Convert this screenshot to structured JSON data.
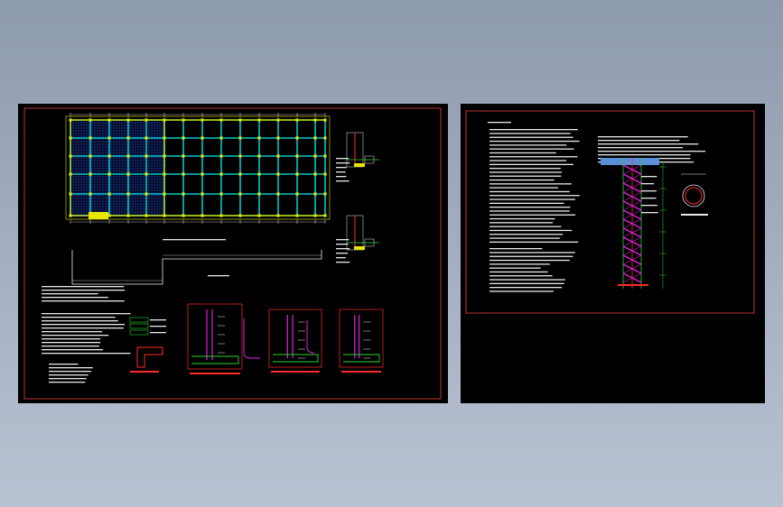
{
  "canvas": {
    "background_colors": [
      "#8e9aad",
      "#b8c2d3"
    ],
    "sheet_color": "#000000"
  },
  "palette": {
    "frame": "#d23a3a",
    "grid_major": "#e6e600",
    "grid_minor": "#00c8c8",
    "hatch": "#2244cc",
    "annotation": "#e8e8e8",
    "detail_red": "#ff2a2a",
    "detail_magenta": "#e020e0",
    "detail_green": "#2ad42a"
  },
  "left_sheet": {
    "plan_caption": "",
    "notes_caption": "",
    "section_captions": []
  },
  "right_sheet": {
    "notes_caption": "",
    "pile_caption": "",
    "circle_caption": ""
  }
}
